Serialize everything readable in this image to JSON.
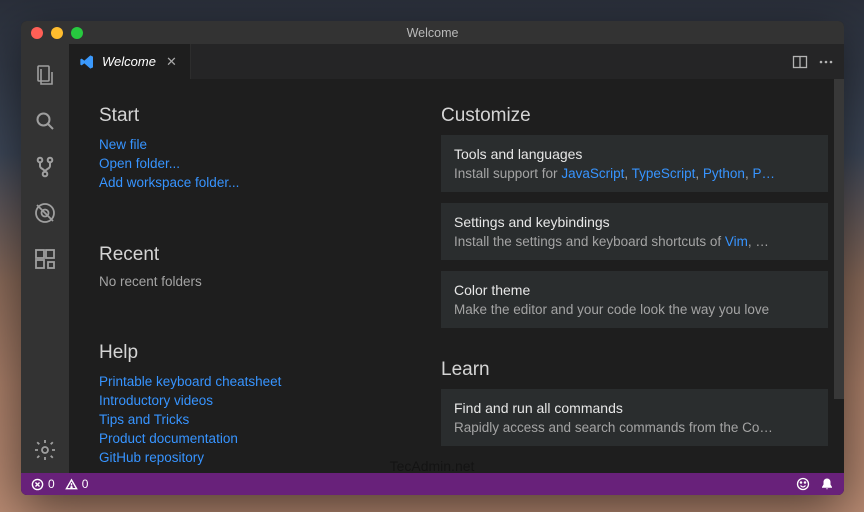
{
  "window_title": "Welcome",
  "tab": {
    "label": "Welcome"
  },
  "activitybar": {
    "items": [
      {
        "name": "explorer-icon"
      },
      {
        "name": "search-icon"
      },
      {
        "name": "git-icon"
      },
      {
        "name": "debug-icon"
      },
      {
        "name": "extensions-icon"
      }
    ],
    "bottom": {
      "name": "settings-gear-icon"
    }
  },
  "start": {
    "heading": "Start",
    "new_file": "New file",
    "open_folder": "Open folder...",
    "add_workspace": "Add workspace folder..."
  },
  "recent": {
    "heading": "Recent",
    "empty": "No recent folders"
  },
  "help": {
    "heading": "Help",
    "cheatsheet": "Printable keyboard cheatsheet",
    "videos": "Introductory videos",
    "tips": "Tips and Tricks",
    "docs": "Product documentation",
    "github": "GitHub repository"
  },
  "customize": {
    "heading": "Customize",
    "tools": {
      "title": "Tools and languages",
      "desc_prefix": "Install support for ",
      "langs": [
        "JavaScript",
        "TypeScript",
        "Python",
        "P…"
      ],
      "sep": ", "
    },
    "keybind": {
      "title": "Settings and keybindings",
      "desc_prefix": "Install the settings and keyboard shortcuts of ",
      "link": "Vim",
      "suffix": ", …"
    },
    "theme": {
      "title": "Color theme",
      "desc": "Make the editor and your code look the way you love"
    }
  },
  "learn": {
    "heading": "Learn",
    "commands": {
      "title": "Find and run all commands",
      "desc": "Rapidly access and search commands from the Co…"
    }
  },
  "statusbar": {
    "errors": "0",
    "warnings": "0"
  },
  "watermark": "TecAdmin.net"
}
